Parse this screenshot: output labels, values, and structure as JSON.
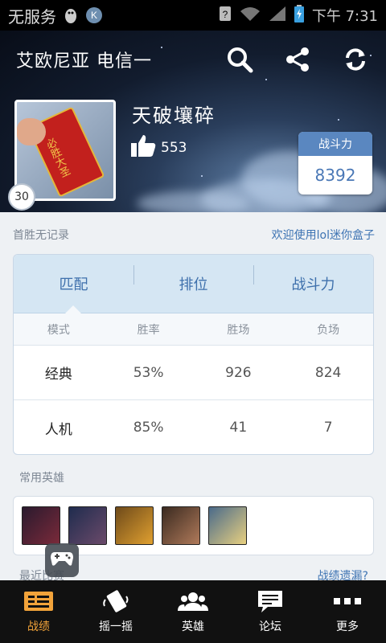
{
  "status_bar": {
    "carrier": "无服务",
    "time": "下午 7:31"
  },
  "header": {
    "server": "艾欧尼亚 电信一",
    "player_name": "天破壤碎",
    "likes": "553",
    "level": "30",
    "power_label": "战斗力",
    "power_value": "8392",
    "avatar_text": "必胜大圣"
  },
  "info": {
    "first_win": "首胜无记录",
    "welcome": "欢迎使用lol迷你盒子"
  },
  "tabs": [
    "匹配",
    "排位",
    "战斗力"
  ],
  "table": {
    "headers": [
      "模式",
      "胜率",
      "胜场",
      "负场"
    ],
    "rows": [
      {
        "mode": "经典",
        "rate": "53%",
        "wins": "926",
        "losses": "824"
      },
      {
        "mode": "人机",
        "rate": "85%",
        "wins": "41",
        "losses": "7"
      }
    ]
  },
  "heroes_label": "常用英雄",
  "heroes": [
    {
      "color_a": "#2a1a2e",
      "color_b": "#7a2a3a"
    },
    {
      "color_a": "#1f2c4e",
      "color_b": "#6b4a6a"
    },
    {
      "color_a": "#6e4a1a",
      "color_b": "#e0a030"
    },
    {
      "color_a": "#3a2a20",
      "color_b": "#b07a5a"
    },
    {
      "color_a": "#4a6a8a",
      "color_b": "#e8d080"
    }
  ],
  "recent": {
    "label": "最近比赛",
    "link": "战绩遗漏?"
  },
  "nav": [
    {
      "label": "战绩",
      "icon": "record-icon",
      "active": true
    },
    {
      "label": "摇一摇",
      "icon": "shake-icon",
      "active": false
    },
    {
      "label": "英雄",
      "icon": "heroes-icon",
      "active": false
    },
    {
      "label": "论坛",
      "icon": "forum-icon",
      "active": false
    },
    {
      "label": "更多",
      "icon": "more-icon",
      "active": false
    }
  ],
  "colors": {
    "accent": "#3e70ac",
    "nav_active": "#f2a33a",
    "power_header": "#5a87c0"
  }
}
